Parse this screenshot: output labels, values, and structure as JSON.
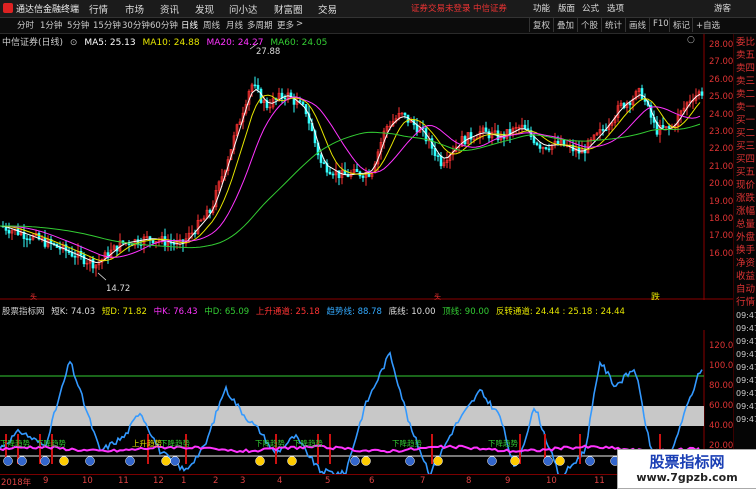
{
  "titlebar": {
    "app_name": "通达信金融终端",
    "menus": [
      "行情",
      "市场",
      "资讯",
      "发现",
      "问小达",
      "财富圈",
      "交易"
    ],
    "status": "证券交易未登录",
    "broker": "中信证券",
    "right_menus": [
      "功能",
      "版面",
      "公式",
      "选项",
      "游客"
    ]
  },
  "toolbar": {
    "periods": [
      "分时",
      "1分钟",
      "5分钟",
      "15分钟",
      "30分钟",
      "60分钟",
      "日线",
      "周线",
      "月线",
      "多周期",
      "更多"
    ],
    "active_period": "日线",
    "more_suffix": ">",
    "right_tools": [
      "复权",
      "叠加",
      "个股",
      "统计",
      "画线",
      "F10",
      "标记",
      "+自选"
    ]
  },
  "main_chart": {
    "legend_stock": "中信证券(日线)",
    "ma5": "MA5: 25.13",
    "ma10": "MA10: 24.88",
    "ma20": "MA20: 24.27",
    "ma60": "MA60: 24.05",
    "high_label": "27.88",
    "low_label": "14.72",
    "y_ticks": [
      "28.00",
      "27.00",
      "26.00",
      "25.00",
      "24.00",
      "23.00",
      "22.00",
      "21.00",
      "20.00",
      "19.00",
      "18.00",
      "17.00",
      "16.00"
    ],
    "marker_sell": "跌",
    "marker_small": "头",
    "colors": {
      "ma5": "#ffffff",
      "ma10": "#e6e600",
      "ma20": "#ff33ff",
      "ma60": "#33cc33",
      "up": "#ff3333",
      "down": "#33ffff"
    }
  },
  "indicator": {
    "name": "股票指标网",
    "short_k": "短K: 74.03",
    "short_d": "短D: 71.82",
    "mid_k": "中K: 76.43",
    "mid_d": "中D: 65.09",
    "rise_channel": "上升通道: 25.18",
    "trend_line": "趋势线: 88.78",
    "bottom_line": "底线: 10.00",
    "top_line": "顶线: 90.00",
    "reversal": "反转通道: 24.44 : 25.18 : 24.44",
    "y_ticks": [
      "120.00",
      "100.00",
      "80.00",
      "60.00",
      "40.00",
      "20.00",
      "0.00"
    ],
    "labels": [
      "下降趋势",
      "下降趋势",
      "上升趋势",
      "下降趋势",
      "下降趋势",
      "下降趋势",
      "下降趋势",
      "下降趋势"
    ]
  },
  "right_column": {
    "items": [
      "委比",
      "卖五",
      "卖四",
      "卖三",
      "卖二",
      "卖一",
      "买一",
      "买二",
      "买三",
      "买四",
      "买五",
      "现价",
      "涨跌",
      "涨幅",
      "总量",
      "外盘",
      "换手",
      "净资",
      "收益",
      "自动",
      "行情"
    ],
    "times": [
      "09:47",
      "09:47",
      "09:47",
      "09:47",
      "09:47",
      "09:47",
      "09:47",
      "09:47",
      "09:47"
    ]
  },
  "x_axis": {
    "labels": [
      "2018年",
      "9",
      "10",
      "11",
      "12",
      "1",
      "2",
      "3",
      "4",
      "5",
      "6",
      "7",
      "8",
      "9",
      "10",
      "11",
      "12"
    ]
  },
  "watermark": {
    "title": "股票指标网",
    "url": "www.7gpzb.com"
  }
}
